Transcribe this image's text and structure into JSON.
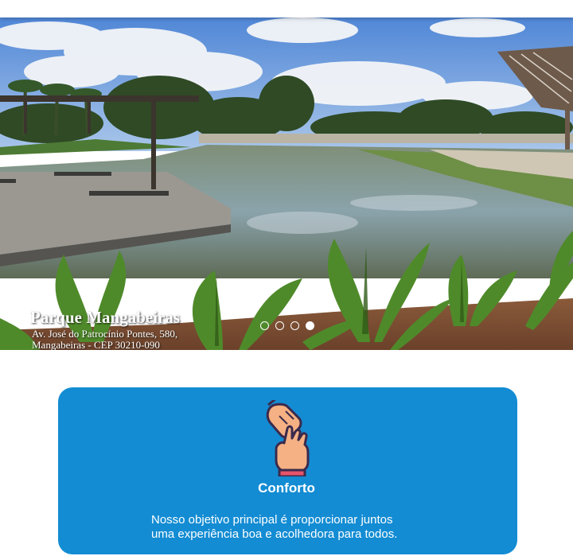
{
  "hero": {
    "title": "Parque Mangabeiras",
    "address_line1": "Av. José do Patrocínio Pontes, 580,",
    "address_line2": "Mangabeiras - CEP 30210-090",
    "slides": [
      {
        "label": "slide 1",
        "active": false
      },
      {
        "label": "slide 2",
        "active": false
      },
      {
        "label": "slide 3",
        "active": false
      },
      {
        "label": "slide 4",
        "active": true
      }
    ]
  },
  "feature": {
    "icon": "helping-hands-icon",
    "title": "Conforto",
    "text_line1": "Nosso objetivo principal é proporcionar juntos",
    "text_line2": "uma experiência boa e acolhedora para todos.",
    "color": "#138cd3"
  }
}
